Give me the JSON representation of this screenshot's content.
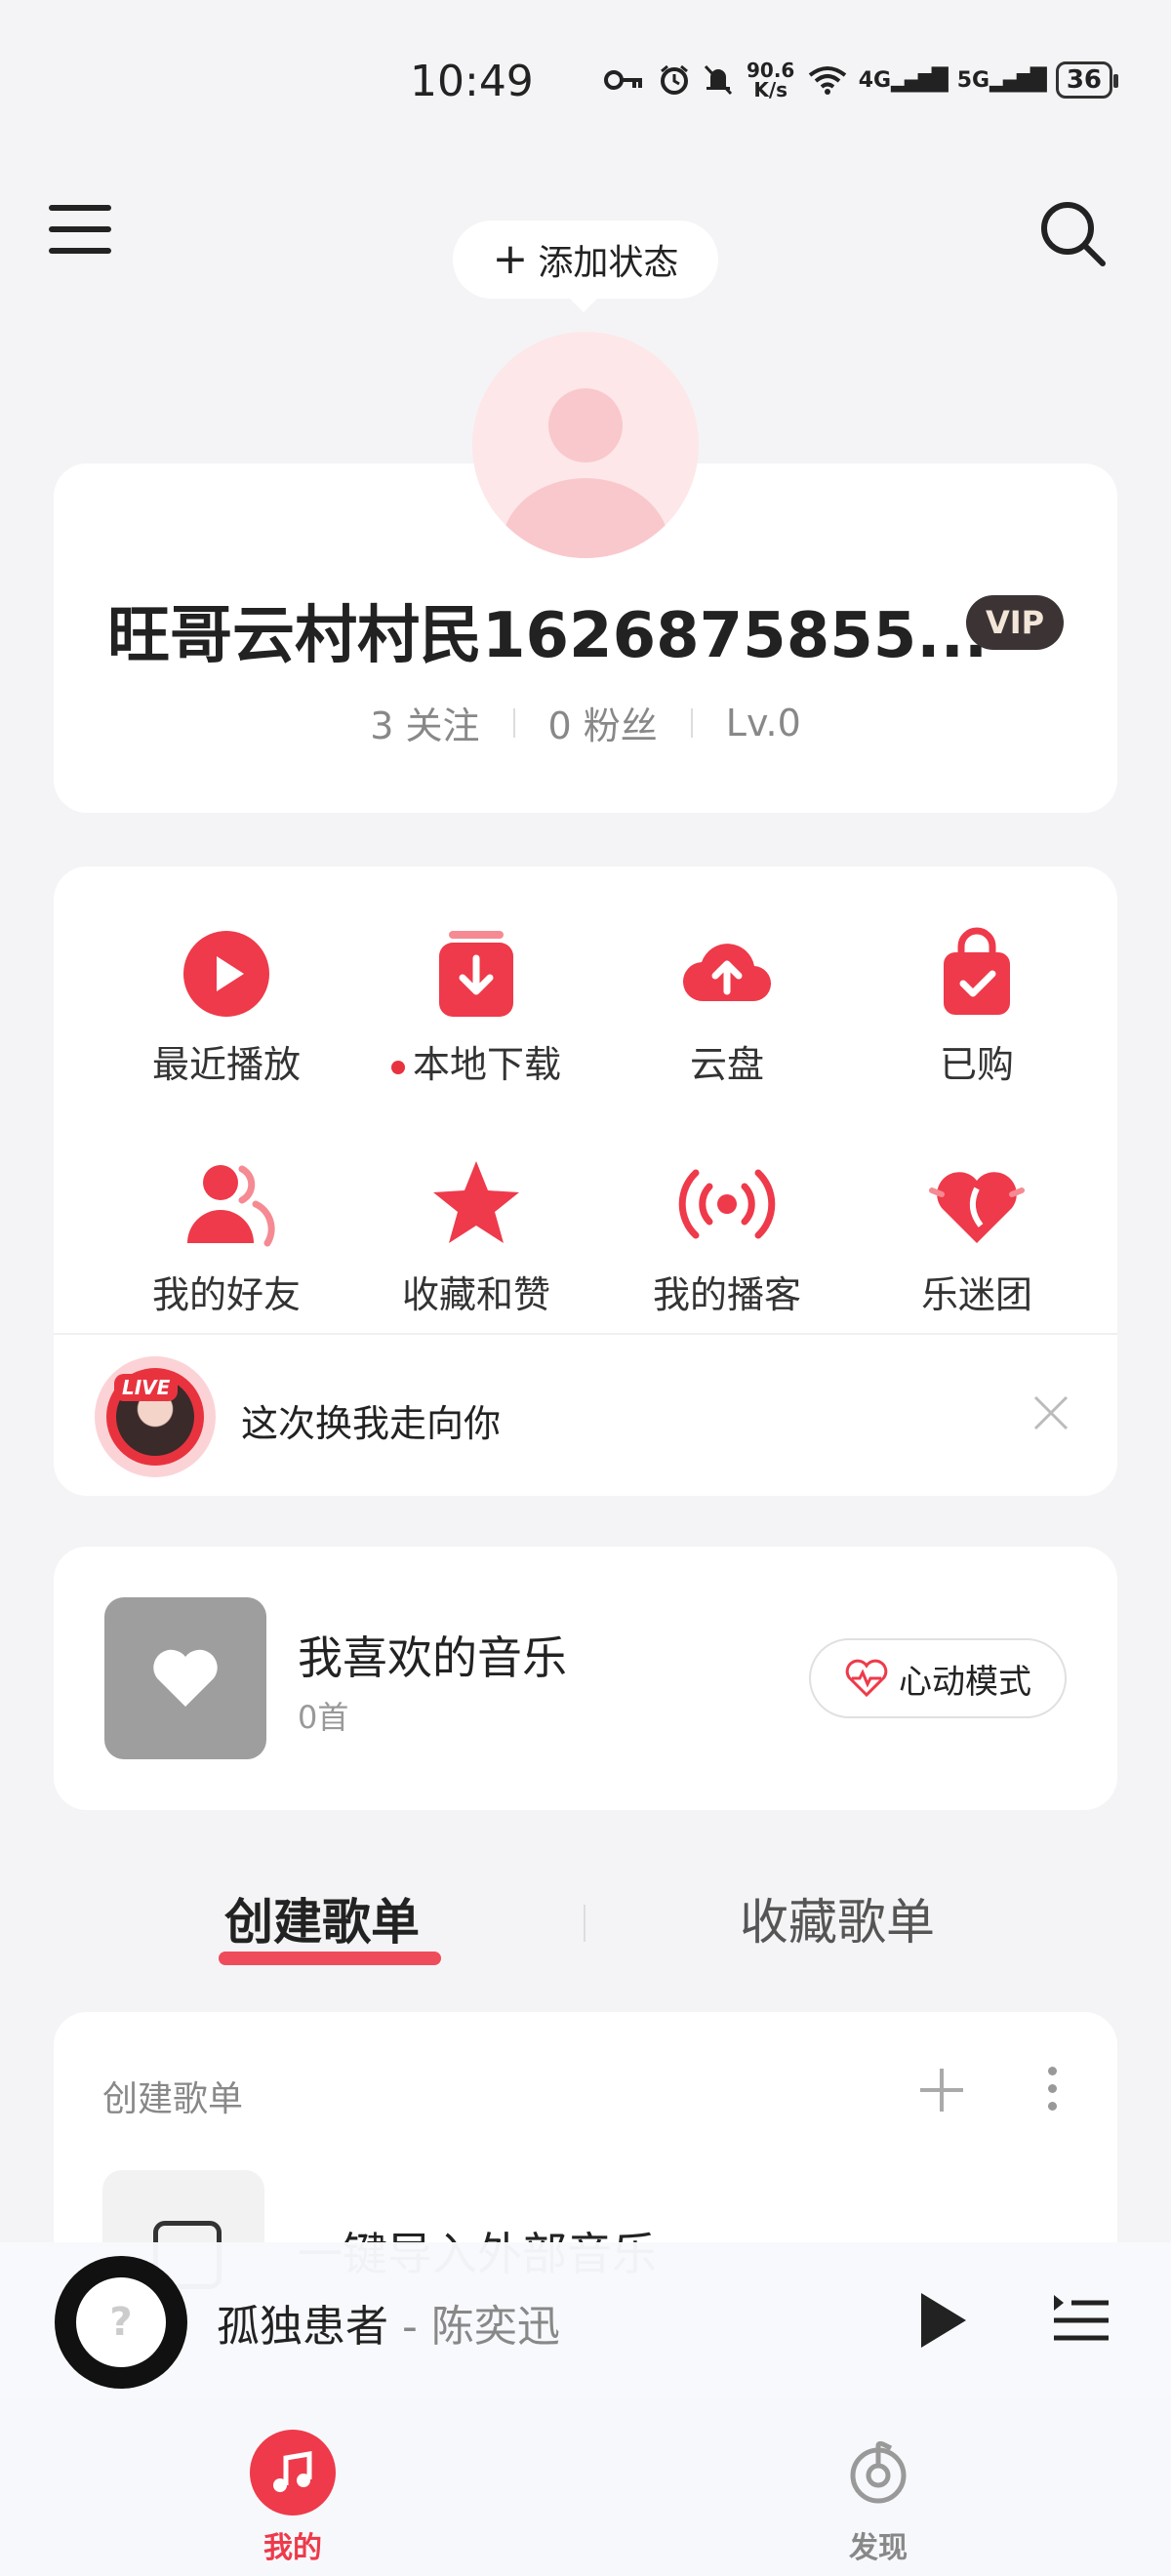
{
  "status_bar": {
    "time": "10:49",
    "net_speed_value": "90.6",
    "net_speed_unit": "K/s",
    "signal_1": "4G",
    "signal_2": "5G",
    "battery": "36"
  },
  "header": {
    "add_status_label": "添加状态",
    "menu_icon": "hamburger-menu-icon",
    "search_icon": "search-icon"
  },
  "profile": {
    "username": "旺哥云村村民1626875855...",
    "vip_label": "VIP",
    "following": "3 关注",
    "followers": "0 粉丝",
    "level": "Lv.0"
  },
  "shortcuts": [
    {
      "label": "最近播放",
      "icon": "play-circle-icon"
    },
    {
      "label": "本地下载",
      "icon": "download-icon",
      "dot": true
    },
    {
      "label": "云盘",
      "icon": "cloud-upload-icon"
    },
    {
      "label": "已购",
      "icon": "shopping-bag-icon"
    },
    {
      "label": "我的好友",
      "icon": "friends-icon"
    },
    {
      "label": "收藏和赞",
      "icon": "star-icon"
    },
    {
      "label": "我的播客",
      "icon": "podcast-icon"
    },
    {
      "label": "乐迷团",
      "icon": "heart-fan-icon"
    }
  ],
  "live_banner": {
    "tag": "LIVE",
    "text": "这次换我走向你"
  },
  "liked_music": {
    "title": "我喜欢的音乐",
    "count": "0首",
    "heart_mode_label": "心动模式"
  },
  "tabs": {
    "created": "创建歌单",
    "collected": "收藏歌单"
  },
  "playlist_section": {
    "header": "创建歌单",
    "import_label": "一键导入外部音乐"
  },
  "now_playing": {
    "title": "孤独患者",
    "artist": " - 陈奕迅"
  },
  "bottom_nav": {
    "mine": "我的",
    "discover": "发现"
  },
  "colors": {
    "accent": "#ee3a4a",
    "background": "#f4f4f6",
    "vip_badge": "#3c3434"
  }
}
